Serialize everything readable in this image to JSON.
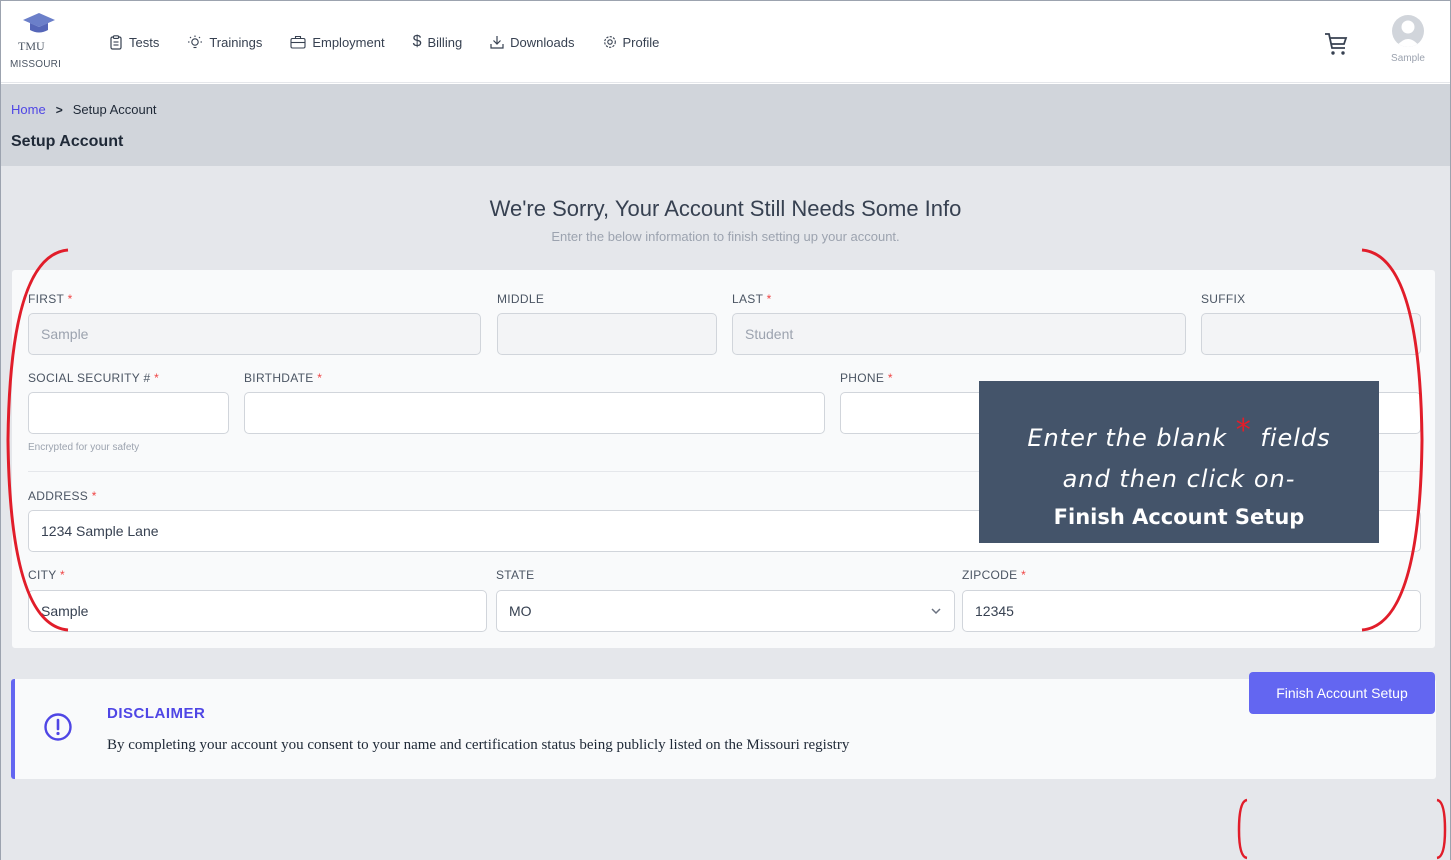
{
  "brand": {
    "line1": "TMU",
    "line2": "MISSOURI"
  },
  "nav": {
    "items": [
      {
        "label": "Tests",
        "icon": "clipboard-icon"
      },
      {
        "label": "Trainings",
        "icon": "lightbulb-icon"
      },
      {
        "label": "Employment",
        "icon": "briefcase-icon"
      },
      {
        "label": "Billing",
        "icon": "dollar-icon"
      },
      {
        "label": "Downloads",
        "icon": "download-icon"
      },
      {
        "label": "Profile",
        "icon": "gear-icon"
      }
    ],
    "cart_icon": "cart-icon",
    "user_name": "Sample"
  },
  "breadcrumb": {
    "home": "Home",
    "current": "Setup Account"
  },
  "page_title": "Setup Account",
  "notice": {
    "title": "We're Sorry, Your Account Still Needs Some Info",
    "subtitle": "Enter the below information to finish setting up your account."
  },
  "form": {
    "first": {
      "label": "FIRST",
      "value": "Sample",
      "required": true
    },
    "middle": {
      "label": "MIDDLE",
      "value": "",
      "required": false
    },
    "last": {
      "label": "LAST",
      "value": "Student",
      "required": true
    },
    "suffix": {
      "label": "SUFFIX",
      "value": "",
      "required": false
    },
    "ssn": {
      "label": "SOCIAL SECURITY #",
      "value": "",
      "required": true,
      "hint": "Encrypted for your safety"
    },
    "birthdate": {
      "label": "BIRTHDATE",
      "value": "",
      "required": true
    },
    "phone": {
      "label": "PHONE",
      "value": "",
      "required": true
    },
    "address": {
      "label": "ADDRESS",
      "value": "1234 Sample Lane",
      "required": true
    },
    "city": {
      "label": "CITY",
      "value": "Sample",
      "required": true
    },
    "state": {
      "label": "STATE",
      "value": "MO",
      "required": false
    },
    "zipcode": {
      "label": "ZIPCODE",
      "value": "12345",
      "required": true
    },
    "required_mark": "*"
  },
  "callout": {
    "line1_a": "Enter the blank",
    "star": "*",
    "line1_b": "fields",
    "line2": "and then click on-",
    "line3": "Finish Account Setup"
  },
  "disclaimer": {
    "title": "DISCLAIMER",
    "text": "By completing your account you consent to your name and certification status being publicly listed on the Missouri registry"
  },
  "finish_button": "Finish Account Setup",
  "colors": {
    "accent": "#6366f1",
    "required": "#ef4444",
    "annotation": "#e11d2a",
    "callout_bg": "#44546a"
  }
}
